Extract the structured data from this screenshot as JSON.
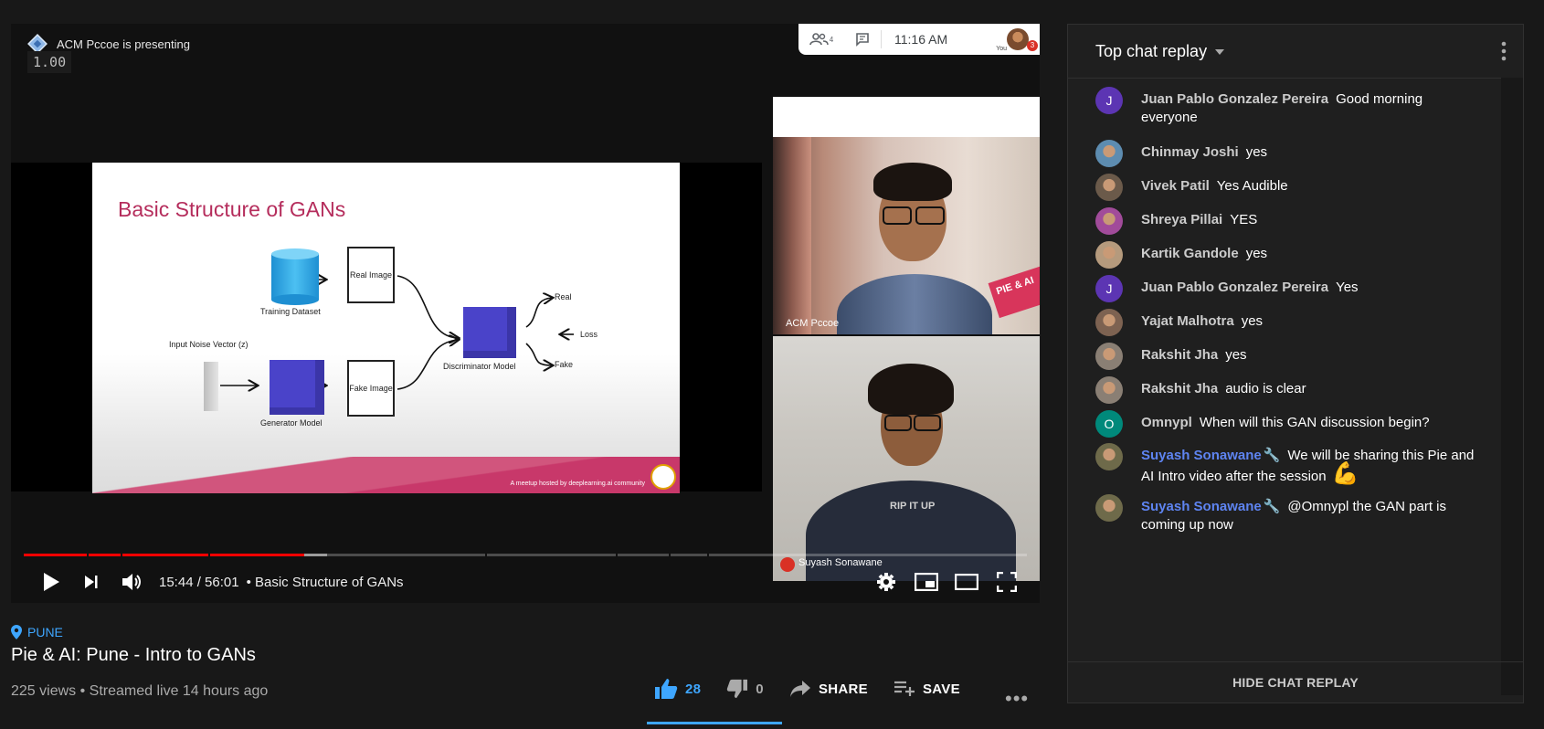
{
  "player": {
    "presenting_text": "ACM Pccoe is presenting",
    "speed_overlay": "1.00",
    "meet": {
      "participants_count": "4",
      "time": "11:16 AM",
      "you_label": "You",
      "badge": "3"
    },
    "slide": {
      "title": "Basic Structure of GANs",
      "training_dataset": "Training Dataset",
      "real_image": "Real Image",
      "input_noise": "Input Noise Vector (z)",
      "generator": "Generator Model",
      "fake_image": "Fake Image",
      "discriminator": "Discriminator Model",
      "real": "Real",
      "loss": "Loss",
      "fake": "Fake",
      "footer": "A meetup hosted by deeplearning.ai community"
    },
    "camera_1_label": "ACM Pccoe",
    "camera_1_overlay": "PIE & AI",
    "camera_2_label": "Suyash Sonawane",
    "camera_2_shirt_text": "RIP IT UP",
    "progress_played_fraction": 0.28,
    "progress_buffered_fraction": 0.302,
    "time_label": "15:44 / 56:01",
    "chapter_label": "• Basic Structure of GANs",
    "controls": [
      "play",
      "next",
      "volume",
      "settings",
      "miniplayer",
      "theater",
      "fullscreen"
    ]
  },
  "video": {
    "location": "PUNE",
    "title": "Pie & AI: Pune - Intro to GANs",
    "stats": "225 views • Streamed live 14 hours ago",
    "like_count": "28",
    "dislike_count": "0",
    "share_label": "SHARE",
    "save_label": "SAVE",
    "more_label": "•••"
  },
  "chat": {
    "title": "Top chat replay",
    "footer": "HIDE CHAT REPLAY",
    "messages": [
      {
        "author": "Juan Pablo Gonzalez Pereira",
        "text": "Good morning everyone",
        "avatar_letter": "J",
        "avatar_color": "#5c35b3"
      },
      {
        "author": "Chinmay Joshi",
        "text": "yes",
        "avatar_letter": "",
        "avatar_color": "#5d8cb0"
      },
      {
        "author": "Vivek Patil",
        "text": "Yes Audible",
        "avatar_letter": "",
        "avatar_color": "#6b5a4a"
      },
      {
        "author": "Shreya Pillai",
        "text": "YES",
        "avatar_letter": "",
        "avatar_color": "#a14b9a"
      },
      {
        "author": "Kartik Gandole",
        "text": "yes",
        "avatar_letter": "",
        "avatar_color": "#b59a7d"
      },
      {
        "author": "Juan Pablo Gonzalez Pereira",
        "text": "Yes",
        "avatar_letter": "J",
        "avatar_color": "#5c35b3"
      },
      {
        "author": "Yajat Malhotra",
        "text": "yes",
        "avatar_letter": "",
        "avatar_color": "#7d6251"
      },
      {
        "author": "Rakshit Jha",
        "text": "yes",
        "avatar_letter": "",
        "avatar_color": "#8a7f74"
      },
      {
        "author": "Rakshit Jha",
        "text": "audio is clear",
        "avatar_letter": "",
        "avatar_color": "#8a7f74"
      },
      {
        "author": "Omnypl",
        "text": "When will this GAN discussion begin?",
        "avatar_letter": "O",
        "avatar_color": "#00897b"
      },
      {
        "author": "Suyash Sonawane",
        "text": "We will be sharing this Pie and AI Intro video after the session",
        "emoji": "💪",
        "avatar_letter": "",
        "avatar_color": "#6e6a4a",
        "owner": true
      },
      {
        "author": "Suyash Sonawane",
        "text": "@Omnypl the GAN part is coming up now",
        "avatar_letter": "",
        "avatar_color": "#6e6a4a",
        "owner": true
      }
    ]
  },
  "colors": {
    "accent_blue": "#3ea6ff",
    "progress_red": "#ff0000",
    "slide_title": "#b52d5c",
    "cube": "#4a43c9",
    "cylinder": "#2fa7e6"
  }
}
